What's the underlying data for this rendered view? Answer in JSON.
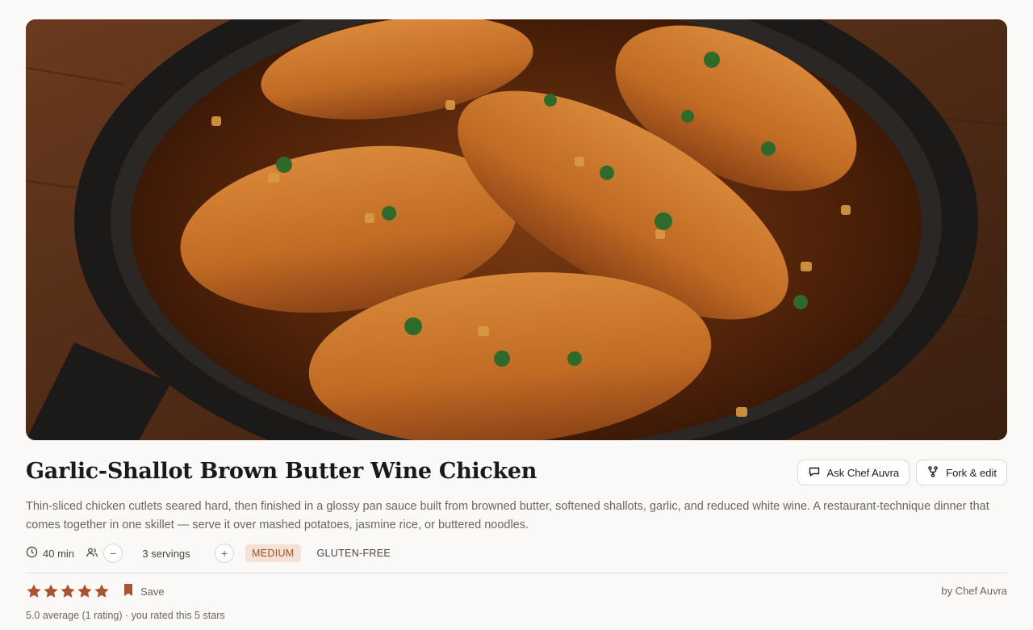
{
  "recipe": {
    "title": "Garlic-Shallot Brown Butter Wine Chicken",
    "description": "Thin-sliced chicken cutlets seared hard, then finished in a glossy pan sauce built from browned butter, softened shallots, garlic, and reduced white wine. A restaurant-technique dinner that comes together in one skillet — serve it over mashed potatoes, jasmine rice, or buttered noodles.",
    "time": "40 min",
    "servings": "3 servings",
    "difficulty": "MEDIUM",
    "diet_tag": "GLUTEN-FREE",
    "author": "by Chef Auvra",
    "rating_summary": "5.0 average (1 rating) · you rated this 5 stars",
    "user_rating": 5,
    "rating_max": 5
  },
  "actions": {
    "ask_label": "Ask Chef Auvra",
    "fork_label": "Fork & edit",
    "save_label": "Save",
    "decrease_symbol": "−",
    "increase_symbol": "+"
  },
  "icons": {
    "time": "clock-icon",
    "servings": "people-icon",
    "ask": "chat-bubble-icon",
    "fork": "fork-branch-icon",
    "save": "bookmark-icon",
    "star": "star-icon"
  },
  "colors": {
    "accent": "#a9532f",
    "badge_bg": "#f6e1d6",
    "badge_text": "#a0502a",
    "text_muted": "#6b6661"
  }
}
